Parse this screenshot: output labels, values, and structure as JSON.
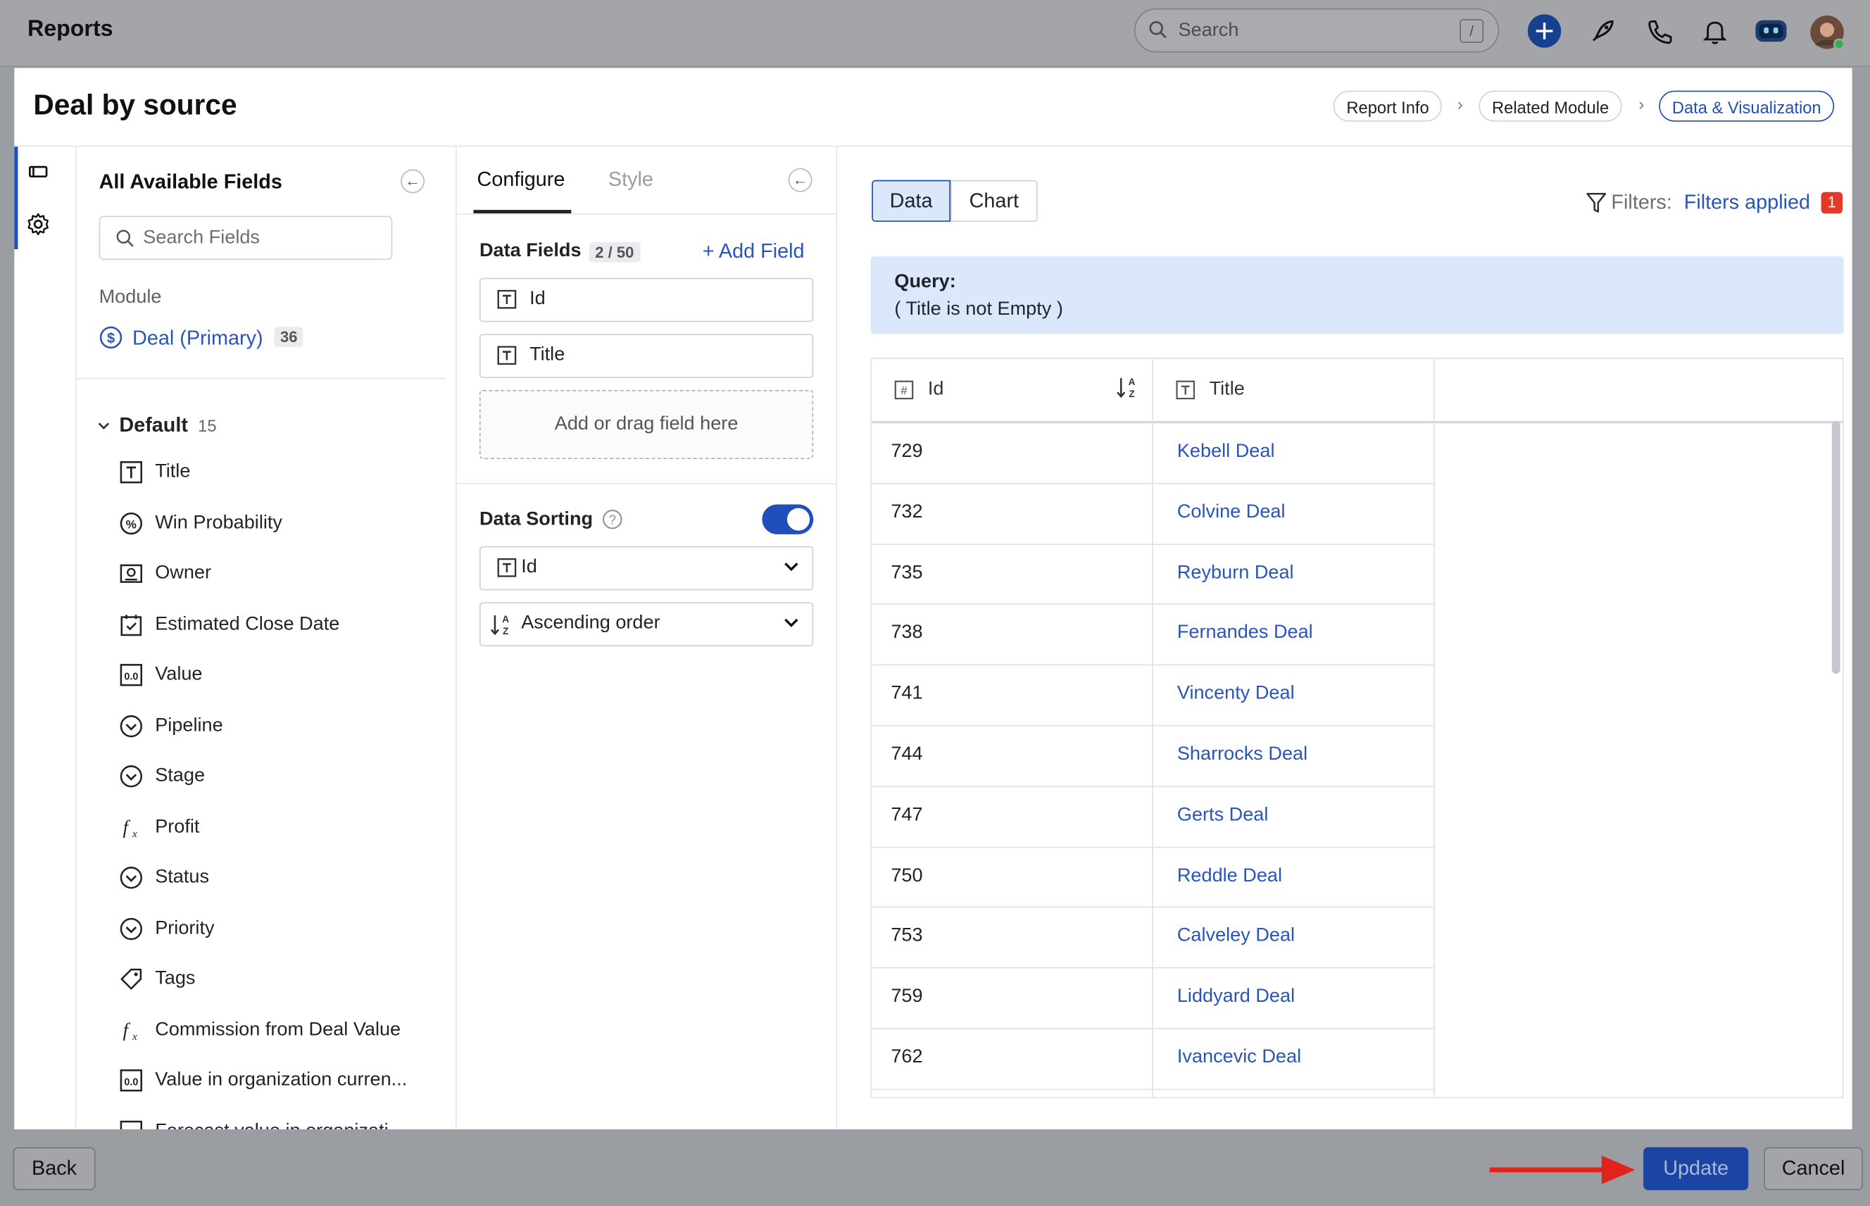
{
  "app": {
    "title": "Reports",
    "search_placeholder": "Search",
    "search_shortcut": "/"
  },
  "header": {
    "report_name": "Deal by source",
    "steps": [
      "Report Info",
      "Related Module",
      "Data & Visualization"
    ],
    "active_step": "Data & Visualization"
  },
  "fields_panel": {
    "title": "All Available Fields",
    "search_placeholder": "Search Fields",
    "module_label": "Module",
    "module_name": "Deal (Primary)",
    "module_count": "36",
    "group_name": "Default",
    "group_count": "15",
    "fields": [
      {
        "label": "Title",
        "icon": "text-field-icon"
      },
      {
        "label": "Win Probability",
        "icon": "percent-icon"
      },
      {
        "label": "Owner",
        "icon": "user-lookup-icon"
      },
      {
        "label": "Estimated Close Date",
        "icon": "calendar-icon"
      },
      {
        "label": "Value",
        "icon": "number-field-icon"
      },
      {
        "label": "Pipeline",
        "icon": "dropdown-icon"
      },
      {
        "label": "Stage",
        "icon": "dropdown-icon"
      },
      {
        "label": "Profit",
        "icon": "formula-icon"
      },
      {
        "label": "Status",
        "icon": "dropdown-icon"
      },
      {
        "label": "Priority",
        "icon": "dropdown-icon"
      },
      {
        "label": "Tags",
        "icon": "tag-icon"
      },
      {
        "label": "Commission from Deal Value",
        "icon": "formula-icon"
      },
      {
        "label": "Value in organization curren...",
        "icon": "number-field-icon"
      },
      {
        "label": "Forecast value in organizati...",
        "icon": "number-field-icon"
      }
    ]
  },
  "configure": {
    "tabs": [
      "Configure",
      "Style"
    ],
    "data_fields_label": "Data Fields",
    "data_fields_count": "2 / 50",
    "add_field_label": "+ Add Field",
    "selected_fields": [
      "Id",
      "Title"
    ],
    "drop_placeholder": "Add or drag field here",
    "sorting_label": "Data Sorting",
    "sorting_enabled": true,
    "sort_field": "Id",
    "sort_order": "Ascending order"
  },
  "data_view": {
    "view_tabs": [
      "Data",
      "Chart"
    ],
    "active_view": "Data",
    "filters_label": "Filters:",
    "filters_applied": "Filters applied",
    "filters_count": "1",
    "query_label": "Query:",
    "query_text": "( Title is not Empty )",
    "columns": [
      "Id",
      "Title"
    ],
    "rows": [
      {
        "id": "729",
        "title": "Kebell Deal"
      },
      {
        "id": "732",
        "title": "Colvine Deal"
      },
      {
        "id": "735",
        "title": "Reyburn Deal"
      },
      {
        "id": "738",
        "title": "Fernandes Deal"
      },
      {
        "id": "741",
        "title": "Vincenty Deal"
      },
      {
        "id": "744",
        "title": "Sharrocks Deal"
      },
      {
        "id": "747",
        "title": "Gerts Deal"
      },
      {
        "id": "750",
        "title": "Reddle Deal"
      },
      {
        "id": "753",
        "title": "Calveley Deal"
      },
      {
        "id": "759",
        "title": "Liddyard Deal"
      },
      {
        "id": "762",
        "title": "Ivancevic Deal"
      }
    ]
  },
  "footer": {
    "back_label": "Back",
    "update_label": "Update",
    "cancel_label": "Cancel"
  },
  "colors": {
    "accent": "#1f4fb8",
    "link": "#2a55b8",
    "query_bg": "#dbe8fb",
    "annotation_arrow": "#e0231b",
    "badge_red": "#e5372a"
  }
}
